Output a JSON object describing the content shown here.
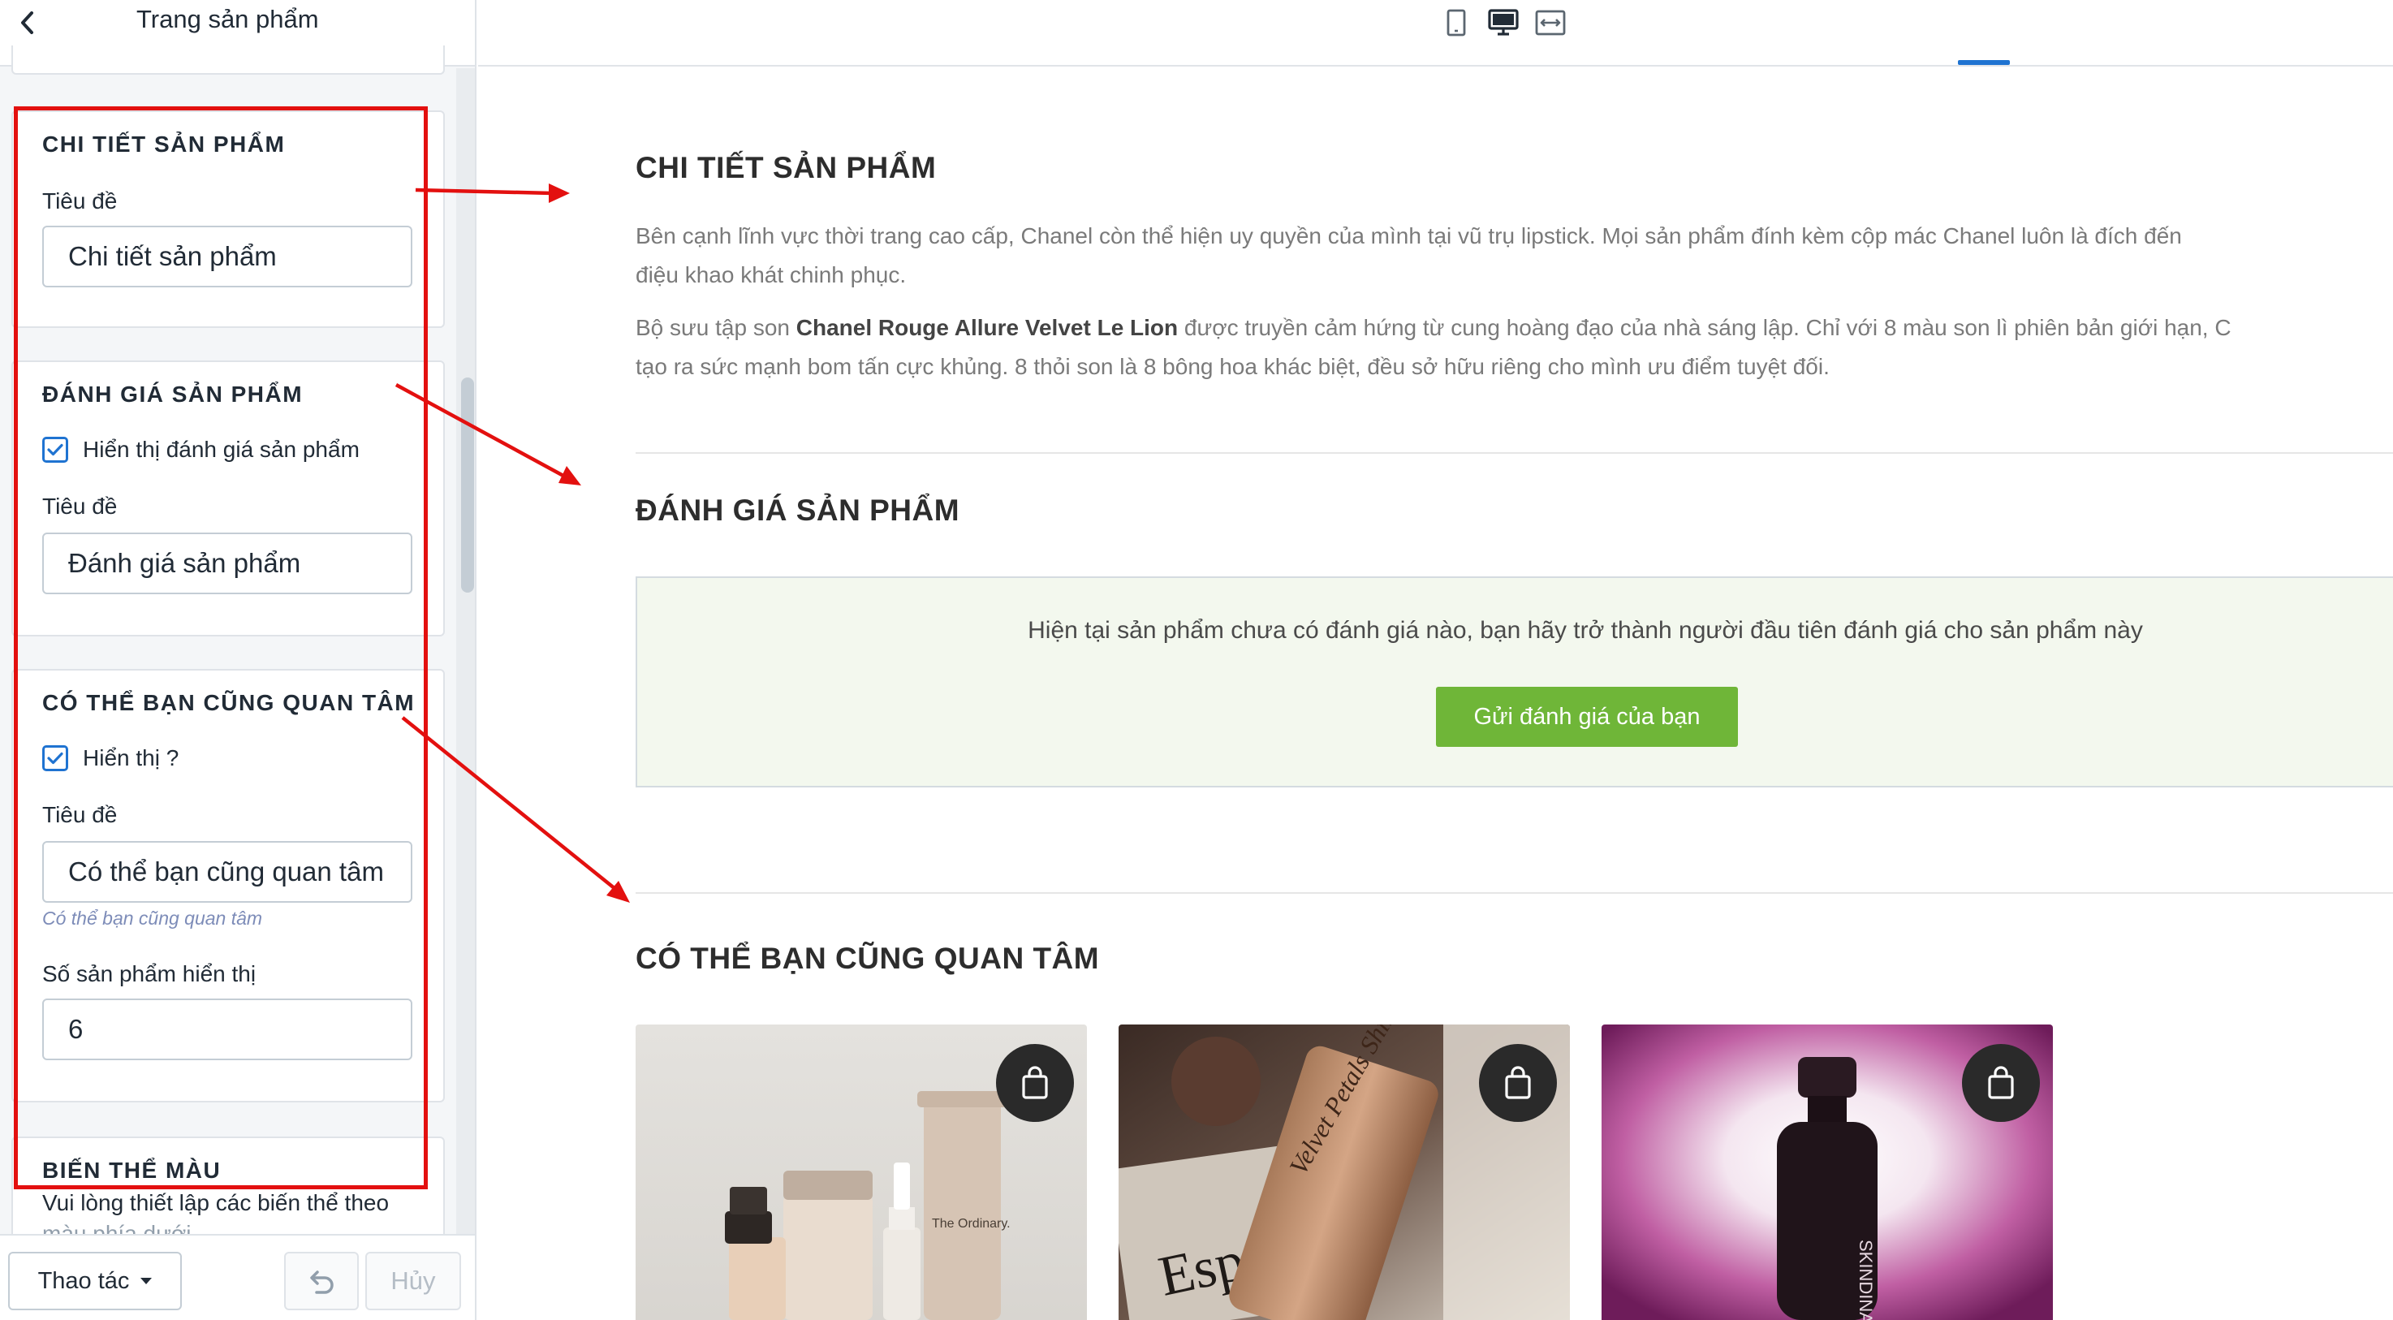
{
  "sidebar": {
    "title": "Trang sản phẩm",
    "sections": {
      "details": {
        "heading": "CHI TIẾT SẢN PHẨM",
        "title_label": "Tiêu đề",
        "title_value": "Chi tiết sản phẩm"
      },
      "reviews": {
        "heading": "ĐÁNH GIÁ SẢN PHẨM",
        "show_label": "Hiển thị đánh giá sản phẩm",
        "show_checked": true,
        "title_label": "Tiêu đề",
        "title_value": "Đánh giá sản phẩm"
      },
      "related": {
        "heading": "CÓ THỂ BẠN CŨNG QUAN TÂM",
        "show_label": "Hiển thị ?",
        "show_checked": true,
        "title_label": "Tiêu đề",
        "title_value": "Có thể bạn cũng quan tâm",
        "title_hint": "Có thể bạn cũng quan tâm",
        "count_label": "Số sản phẩm hiển thị",
        "count_value": "6"
      },
      "color_variants": {
        "heading": "BIẾN THỂ MÀU",
        "description_line1": "Vui lòng thiết lập các biến thể theo",
        "description_line2": "màu phía dưới"
      }
    },
    "footer": {
      "actions_label": "Thao tác",
      "cancel_label": "Hủy"
    }
  },
  "devices": [
    "mobile-icon",
    "desktop-icon",
    "full-width-icon"
  ],
  "active_device": "desktop-icon",
  "preview": {
    "details": {
      "heading": "CHI TIẾT SẢN PHẨM",
      "para1_line1": "Bên cạnh lĩnh vực thời trang cao cấp, Chanel còn thể hiện uy quyền của mình tại vũ trụ lipstick. Mọi sản phẩm đính kèm cộp mác Chanel luôn là đích đến",
      "para1_line2": "điệu khao khát chinh phục.",
      "para2_prefix": "Bộ sưu tập son ",
      "para2_bold": "Chanel Rouge Allure Velvet Le Lion",
      "para2_suffix": " được truyền cảm hứng từ cung hoàng đạo của nhà sáng lập. Chỉ với 8 màu son lì phiên bản giới hạn, C",
      "para2_line2": "tạo ra sức mạnh bom tấn cực khủng. 8 thỏi son là 8 bông hoa khác biệt, đều sở hữu riêng cho mình ưu điểm tuyệt đối."
    },
    "reviews": {
      "heading": "ĐÁNH GIÁ SẢN PHẨM",
      "empty_text": "Hiện tại sản phẩm chưa có đánh giá nào, bạn hãy trở thành người đầu tiên đánh giá cho sản phẩm này",
      "button_label": "Gửi đánh giá của bạn"
    },
    "related": {
      "heading": "CÓ THỂ BẠN CŨNG QUAN TÂM",
      "product_images": [
        "The Ordinary skincare bottles",
        "Velvet Petals Shimmer tube",
        "SKINDINAVIA spray bottle"
      ],
      "product_texts": {
        "ordinary_label": "The Ordinary.",
        "shimmer_brand": "Velvet Petals Shimmer",
        "magazine": "Esprit",
        "spray_brand": "SKINDINA"
      }
    }
  },
  "colors": {
    "accent_blue": "#1f73d1",
    "review_button_green": "#6fb638",
    "review_box_bg": "#f3f8ee",
    "annotation_red": "#e3100f"
  }
}
